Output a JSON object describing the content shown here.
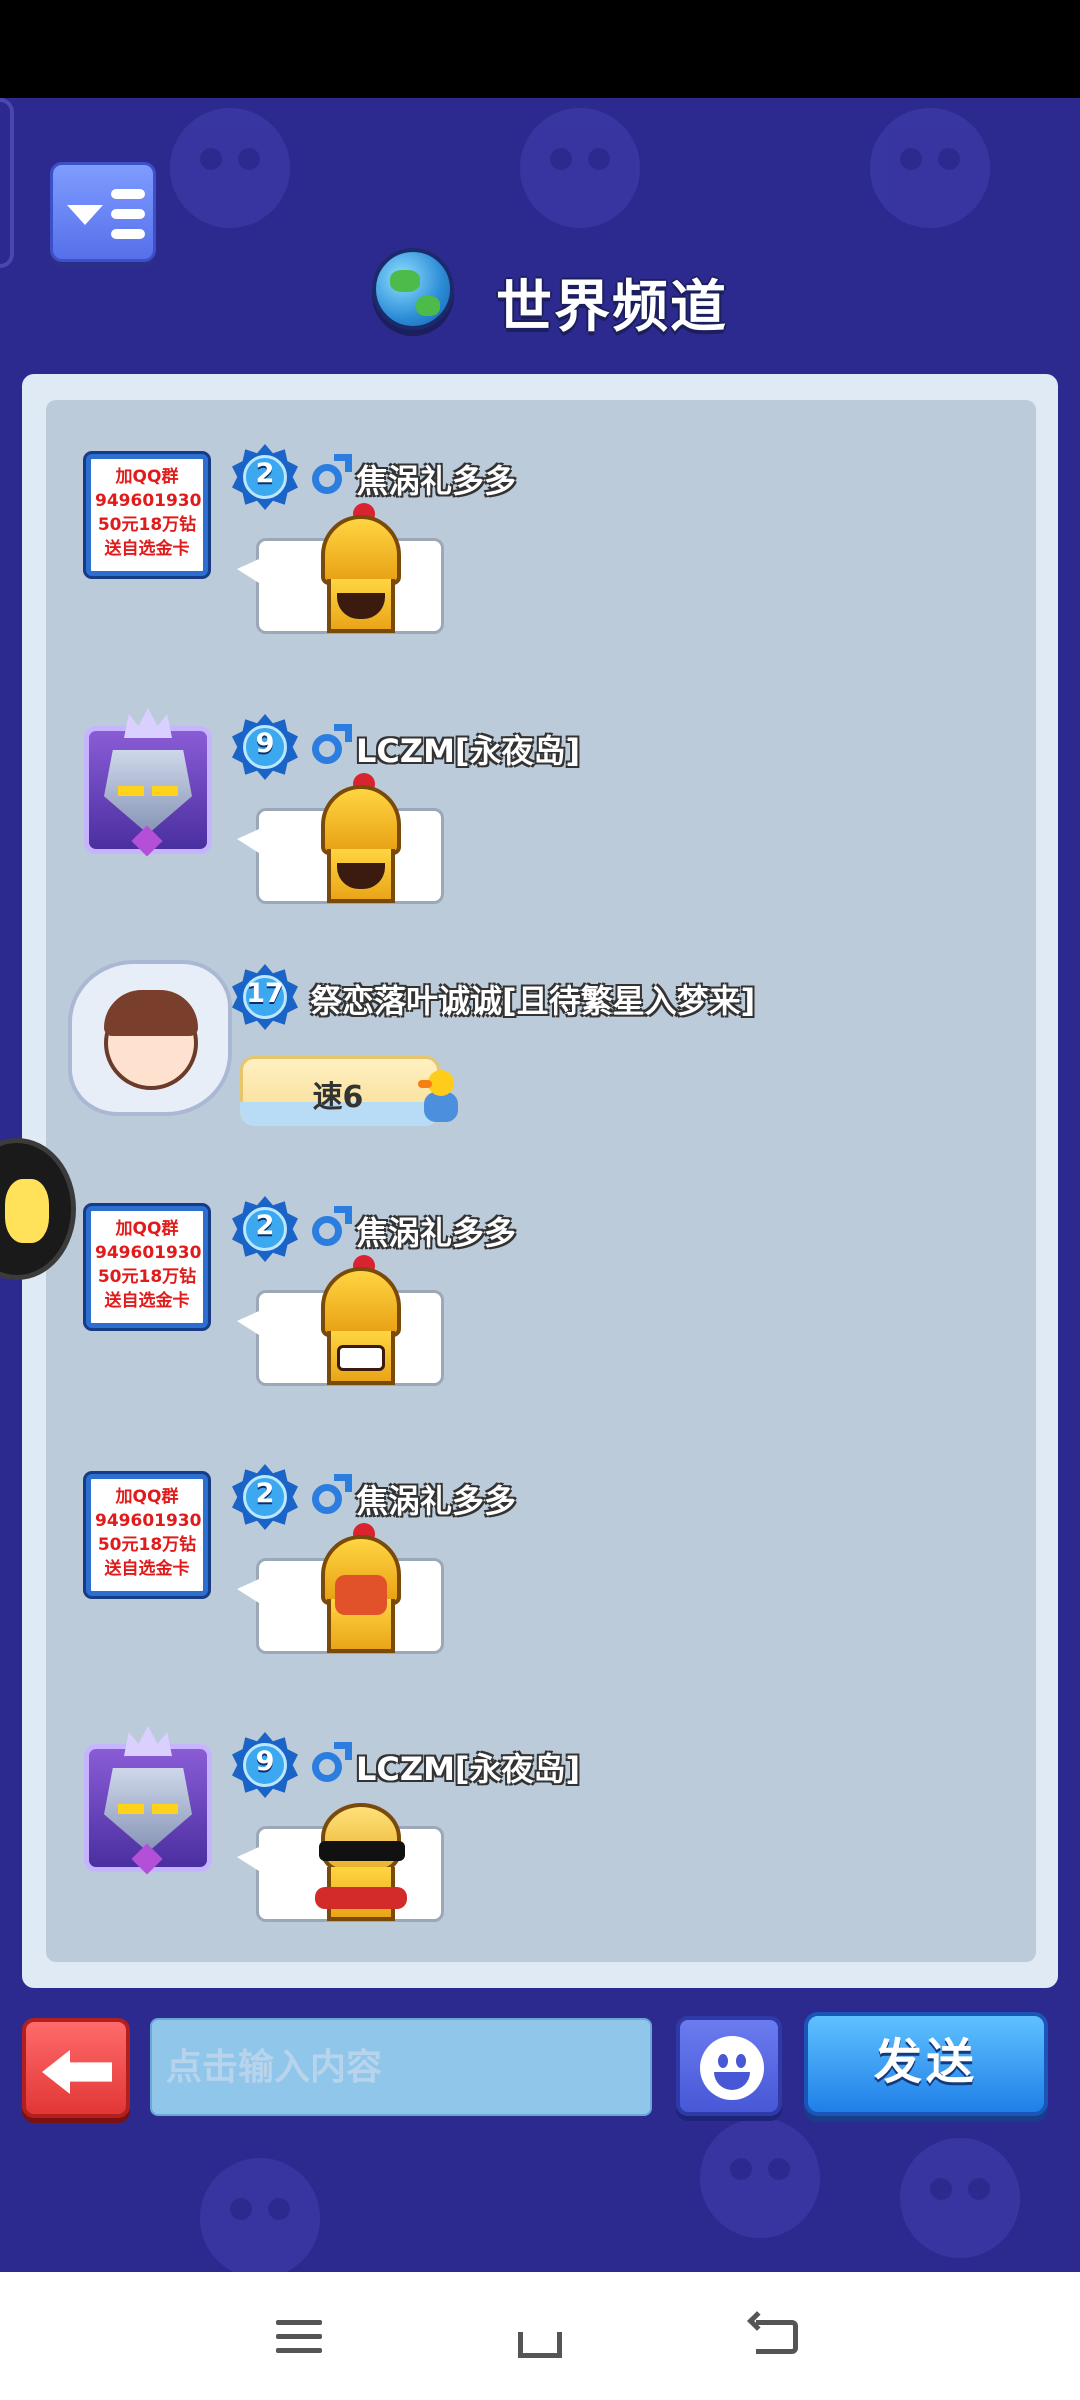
{
  "header": {
    "title": "世界频道",
    "menu_icon": "menu-list-icon",
    "globe_icon": "globe-icon"
  },
  "messages": [
    {
      "avatar": "qq-ad",
      "avatar_lines": [
        "加QQ群",
        "949601930",
        "50元18万钻",
        "送自选金卡"
      ],
      "level": "2",
      "gender": "male",
      "name": "焦涡礼多多",
      "content": "sticker-laughing-knight"
    },
    {
      "avatar": "robot",
      "level": "9",
      "gender": "male",
      "name": "LCZM[永夜岛]",
      "content": "sticker-laughing-knight"
    },
    {
      "avatar": "girl",
      "level": "17",
      "name": "祭恋落叶诚诚[且待繁星入梦来]",
      "content": "速6"
    },
    {
      "avatar": "qq-ad",
      "avatar_lines": [
        "加QQ群",
        "949601930",
        "50元18万钻",
        "送自选金卡"
      ],
      "level": "2",
      "gender": "male",
      "name": "焦涡礼多多",
      "content": "sticker-grinning-knight"
    },
    {
      "avatar": "qq-ad",
      "avatar_lines": [
        "加QQ群",
        "949601930",
        "50元18万钻",
        "送自选金卡"
      ],
      "level": "2",
      "gender": "male",
      "name": "焦涡礼多多",
      "content": "sticker-angry-knight"
    },
    {
      "avatar": "robot",
      "level": "9",
      "gender": "male",
      "name": "LCZM[永夜岛]",
      "content": "sticker-cool-knight"
    }
  ],
  "input": {
    "placeholder": "点击输入内容",
    "value": ""
  },
  "buttons": {
    "back_icon": "back-arrow-icon",
    "emoji_icon": "smiley-icon",
    "send_label": "发送"
  },
  "colors": {
    "background": "#2d2a8f",
    "chat_panel": "#bccbd9",
    "send_button": "#1f7fe8",
    "back_button": "#e33636",
    "qq_text": "#e11b1b"
  },
  "nav": {
    "menu_icon": "menu-icon",
    "home_icon": "home-icon",
    "back_icon": "back-icon"
  }
}
